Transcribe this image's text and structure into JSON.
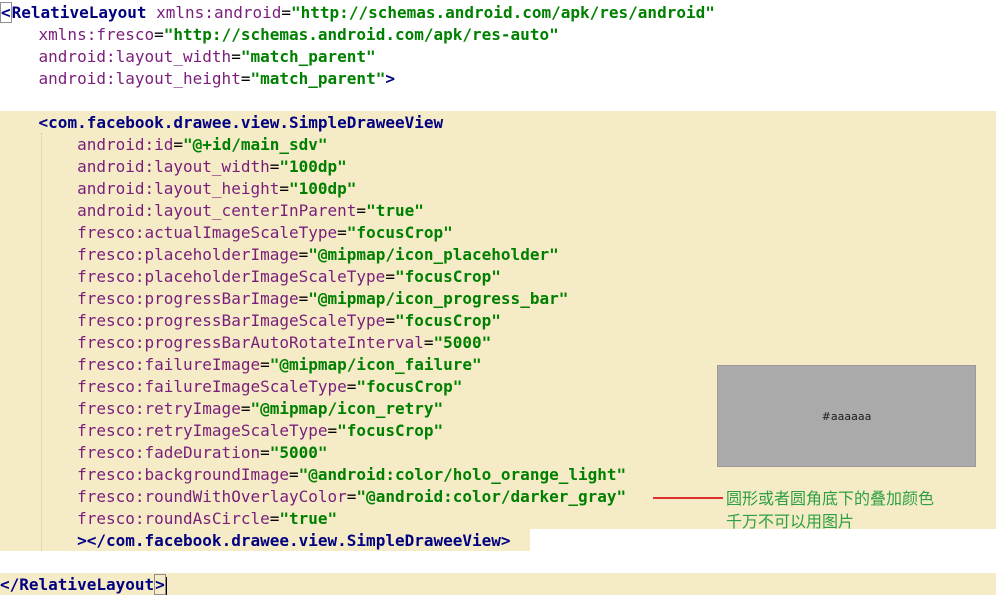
{
  "code": {
    "lines": [
      [
        {
          "c": "p",
          "t": "<"
        },
        {
          "c": "t",
          "t": "RelativeLayout "
        },
        {
          "c": "a",
          "t": "xmlns:android"
        },
        {
          "c": "e",
          "t": "="
        },
        {
          "c": "v",
          "t": "\"http://schemas.android.com/apk/res/android\""
        }
      ],
      [
        {
          "c": "e",
          "t": "    "
        },
        {
          "c": "a",
          "t": "xmlns:fresco"
        },
        {
          "c": "e",
          "t": "="
        },
        {
          "c": "v",
          "t": "\"http://schemas.android.com/apk/res-auto\""
        }
      ],
      [
        {
          "c": "e",
          "t": "    "
        },
        {
          "c": "a",
          "t": "android:layout_width"
        },
        {
          "c": "e",
          "t": "="
        },
        {
          "c": "v",
          "t": "\"match_parent\""
        }
      ],
      [
        {
          "c": "e",
          "t": "    "
        },
        {
          "c": "a",
          "t": "android:layout_height"
        },
        {
          "c": "e",
          "t": "="
        },
        {
          "c": "v",
          "t": "\"match_parent\""
        },
        {
          "c": "p",
          "t": ">"
        }
      ],
      [],
      [
        {
          "c": "e",
          "t": "    "
        },
        {
          "c": "p",
          "t": "<"
        },
        {
          "c": "t",
          "t": "com.facebook.drawee.view.SimpleDraweeView"
        }
      ],
      [
        {
          "c": "e",
          "t": "        "
        },
        {
          "c": "a",
          "t": "android:id"
        },
        {
          "c": "e",
          "t": "="
        },
        {
          "c": "v",
          "t": "\"@+id/main_sdv\""
        }
      ],
      [
        {
          "c": "e",
          "t": "        "
        },
        {
          "c": "a",
          "t": "android:layout_width"
        },
        {
          "c": "e",
          "t": "="
        },
        {
          "c": "v",
          "t": "\"100dp\""
        }
      ],
      [
        {
          "c": "e",
          "t": "        "
        },
        {
          "c": "a",
          "t": "android:layout_height"
        },
        {
          "c": "e",
          "t": "="
        },
        {
          "c": "v",
          "t": "\"100dp\""
        }
      ],
      [
        {
          "c": "e",
          "t": "        "
        },
        {
          "c": "a",
          "t": "android:layout_centerInParent"
        },
        {
          "c": "e",
          "t": "="
        },
        {
          "c": "v",
          "t": "\"true\""
        }
      ],
      [
        {
          "c": "e",
          "t": "        "
        },
        {
          "c": "a",
          "t": "fresco:actualImageScaleType"
        },
        {
          "c": "e",
          "t": "="
        },
        {
          "c": "v",
          "t": "\"focusCrop\""
        }
      ],
      [
        {
          "c": "e",
          "t": "        "
        },
        {
          "c": "a",
          "t": "fresco:placeholderImage"
        },
        {
          "c": "e",
          "t": "="
        },
        {
          "c": "v",
          "t": "\"@mipmap/icon_placeholder\""
        }
      ],
      [
        {
          "c": "e",
          "t": "        "
        },
        {
          "c": "a",
          "t": "fresco:placeholderImageScaleType"
        },
        {
          "c": "e",
          "t": "="
        },
        {
          "c": "v",
          "t": "\"focusCrop\""
        }
      ],
      [
        {
          "c": "e",
          "t": "        "
        },
        {
          "c": "a",
          "t": "fresco:progressBarImage"
        },
        {
          "c": "e",
          "t": "="
        },
        {
          "c": "v",
          "t": "\"@mipmap/icon_progress_bar\""
        }
      ],
      [
        {
          "c": "e",
          "t": "        "
        },
        {
          "c": "a",
          "t": "fresco:progressBarImageScaleType"
        },
        {
          "c": "e",
          "t": "="
        },
        {
          "c": "v",
          "t": "\"focusCrop\""
        }
      ],
      [
        {
          "c": "e",
          "t": "        "
        },
        {
          "c": "a",
          "t": "fresco:progressBarAutoRotateInterval"
        },
        {
          "c": "e",
          "t": "="
        },
        {
          "c": "v",
          "t": "\"5000\""
        }
      ],
      [
        {
          "c": "e",
          "t": "        "
        },
        {
          "c": "a",
          "t": "fresco:failureImage"
        },
        {
          "c": "e",
          "t": "="
        },
        {
          "c": "v",
          "t": "\"@mipmap/icon_failure\""
        }
      ],
      [
        {
          "c": "e",
          "t": "        "
        },
        {
          "c": "a",
          "t": "fresco:failureImageScaleType"
        },
        {
          "c": "e",
          "t": "="
        },
        {
          "c": "v",
          "t": "\"focusCrop\""
        }
      ],
      [
        {
          "c": "e",
          "t": "        "
        },
        {
          "c": "a",
          "t": "fresco:retryImage"
        },
        {
          "c": "e",
          "t": "="
        },
        {
          "c": "v",
          "t": "\"@mipmap/icon_retry\""
        }
      ],
      [
        {
          "c": "e",
          "t": "        "
        },
        {
          "c": "a",
          "t": "fresco:retryImageScaleType"
        },
        {
          "c": "e",
          "t": "="
        },
        {
          "c": "v",
          "t": "\"focusCrop\""
        }
      ],
      [
        {
          "c": "e",
          "t": "        "
        },
        {
          "c": "a",
          "t": "fresco:fadeDuration"
        },
        {
          "c": "e",
          "t": "="
        },
        {
          "c": "v",
          "t": "\"5000\""
        }
      ],
      [
        {
          "c": "e",
          "t": "        "
        },
        {
          "c": "a",
          "t": "fresco:backgroundImage"
        },
        {
          "c": "e",
          "t": "="
        },
        {
          "c": "v",
          "t": "\"@android:color/holo_orange_light\""
        }
      ],
      [
        {
          "c": "e",
          "t": "        "
        },
        {
          "c": "a",
          "t": "fresco:roundWithOverlayColor"
        },
        {
          "c": "e",
          "t": "="
        },
        {
          "c": "v",
          "t": "\"@android:color/darker_gray\""
        }
      ],
      [
        {
          "c": "e",
          "t": "        "
        },
        {
          "c": "a",
          "t": "fresco:roundAsCircle"
        },
        {
          "c": "e",
          "t": "="
        },
        {
          "c": "v",
          "t": "\"true\""
        }
      ],
      [
        {
          "c": "e",
          "t": "        "
        },
        {
          "c": "p",
          "t": "></"
        },
        {
          "c": "t",
          "t": "com.facebook.drawee.view.SimpleDraweeView"
        },
        {
          "c": "p",
          "t": ">"
        }
      ],
      [],
      [
        {
          "c": "p",
          "t": "</"
        },
        {
          "c": "t",
          "t": "RelativeLayout"
        },
        {
          "c": "p",
          "t": ">"
        }
      ]
    ]
  },
  "swatch": {
    "label": "#aaaaaa",
    "color": "#aaaaaa"
  },
  "annotation": {
    "line1": "圆形或者圆角底下的叠加颜色",
    "line2": "千万不可以用图片",
    "color": "#2ea043"
  }
}
